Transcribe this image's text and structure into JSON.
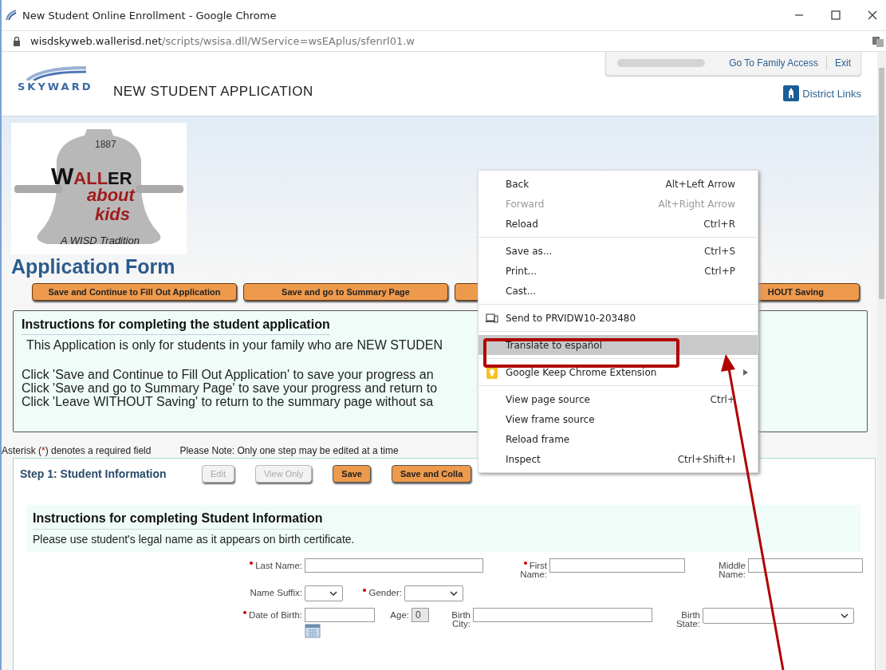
{
  "window": {
    "title": "New Student Online Enrollment - Google Chrome"
  },
  "address_bar": {
    "host": "wisdskyweb.wallerisd.net",
    "path": "/scripts/wsisa.dll/WService=wsEAplus/sfenrl01.w"
  },
  "header": {
    "top_links": [
      "Go To Family Access",
      "Exit"
    ],
    "logo_text": "SKYWARD",
    "title": "NEW STUDENT APPLICATION",
    "district_links": "District Links"
  },
  "school_logo": {
    "year": "1887",
    "name_parts": [
      {
        "text": "W",
        "color": "#111111"
      },
      {
        "text": "ALL",
        "color": "#a01c1c"
      },
      {
        "text": "ER",
        "color": "#111111"
      }
    ],
    "line_2": "about",
    "line_3": "kids",
    "tagline": "A WISD Tradition"
  },
  "page_title": "Application Form",
  "action_buttons": [
    {
      "kind": "labeled",
      "label": "Save and Continue to Fill Out Application"
    },
    {
      "kind": "labeled",
      "label": "Save and go to Summary Page"
    },
    {
      "kind": "blank"
    },
    {
      "kind": "labeled",
      "label": "HOUT Saving"
    }
  ],
  "instructions": {
    "heading": "Instructions for completing the student application",
    "intro": "This Application is only for students in your family who are NEW STUDEN",
    "lines": [
      "Click 'Save and Continue to Fill Out Application' to save your progress an",
      "Click 'Save and go to Summary Page' to save your progress and return to",
      "Click 'Leave WITHOUT Saving' to return to the summary page without sa"
    ]
  },
  "notes": {
    "asterisk": {
      "before": "Asterisk (",
      "mark": "*",
      "after": ") denotes a required field"
    },
    "edit_note": "Please Note: Only one step may be edited at a time"
  },
  "step": {
    "title": "Step 1: Student Information",
    "buttons": [
      {
        "label": "Edit",
        "disabled": true
      },
      {
        "label": "View Only",
        "disabled": true
      },
      {
        "label": "Save",
        "disabled": false
      },
      {
        "label": "Save and Colla",
        "disabled": false
      }
    ],
    "instructions_heading": "Instructions for completing Student Information",
    "instructions_text": "Please use student's legal name as it appears on birth certificate.",
    "fields": [
      {
        "label": "Last Name:",
        "kind": "text",
        "required": true
      },
      {
        "label": "First Name:",
        "kind": "text",
        "required": true
      },
      {
        "label": "Middle Name:",
        "kind": "text",
        "required": false
      },
      {
        "label": "Name Suffix:",
        "kind": "select",
        "required": false
      },
      {
        "label": "Gender:",
        "kind": "select",
        "required": true
      },
      {
        "label": "Date of Birth:",
        "kind": "date",
        "required": true
      },
      {
        "label": "Age:",
        "kind": "readonly",
        "required": false,
        "value": "0"
      },
      {
        "label": "Birth City:",
        "kind": "text",
        "required": false
      },
      {
        "label": "Birth State:",
        "kind": "select",
        "required": false
      }
    ]
  },
  "context_menu": [
    {
      "kind": "item",
      "label": "Back",
      "shortcut": "Alt+Left Arrow",
      "disabled": false,
      "selected": false
    },
    {
      "kind": "item",
      "label": "Forward",
      "shortcut": "Alt+Right Arrow",
      "disabled": true,
      "selected": false
    },
    {
      "kind": "item",
      "label": "Reload",
      "shortcut": "Ctrl+R",
      "disabled": false,
      "selected": false
    },
    {
      "kind": "separator"
    },
    {
      "kind": "item",
      "label": "Save as...",
      "shortcut": "Ctrl+S",
      "disabled": false,
      "selected": false
    },
    {
      "kind": "item",
      "label": "Print...",
      "shortcut": "Ctrl+P",
      "disabled": false,
      "selected": false
    },
    {
      "kind": "item",
      "label": "Cast...",
      "disabled": false,
      "selected": false
    },
    {
      "kind": "separator"
    },
    {
      "kind": "cast",
      "label": "Send to PRVIDW10-203480",
      "disabled": false,
      "selected": false
    },
    {
      "kind": "separator"
    },
    {
      "kind": "item",
      "label": "Translate to español",
      "disabled": false,
      "selected": true
    },
    {
      "kind": "separator"
    },
    {
      "kind": "extension",
      "label": "Google Keep Chrome Extension",
      "disabled": false,
      "selected": false,
      "submenu": true
    },
    {
      "kind": "separator"
    },
    {
      "kind": "item",
      "label": "View page source",
      "shortcut": "Ctrl+",
      "disabled": false,
      "selected": false
    },
    {
      "kind": "item",
      "label": "View frame source",
      "disabled": false,
      "selected": false
    },
    {
      "kind": "item",
      "label": "Reload frame",
      "disabled": false,
      "selected": false
    },
    {
      "kind": "item",
      "label": "Inspect",
      "shortcut": "Ctrl+Shift+I",
      "disabled": false,
      "selected": false
    }
  ],
  "annotation": {
    "highlight": true,
    "arrow": true
  }
}
